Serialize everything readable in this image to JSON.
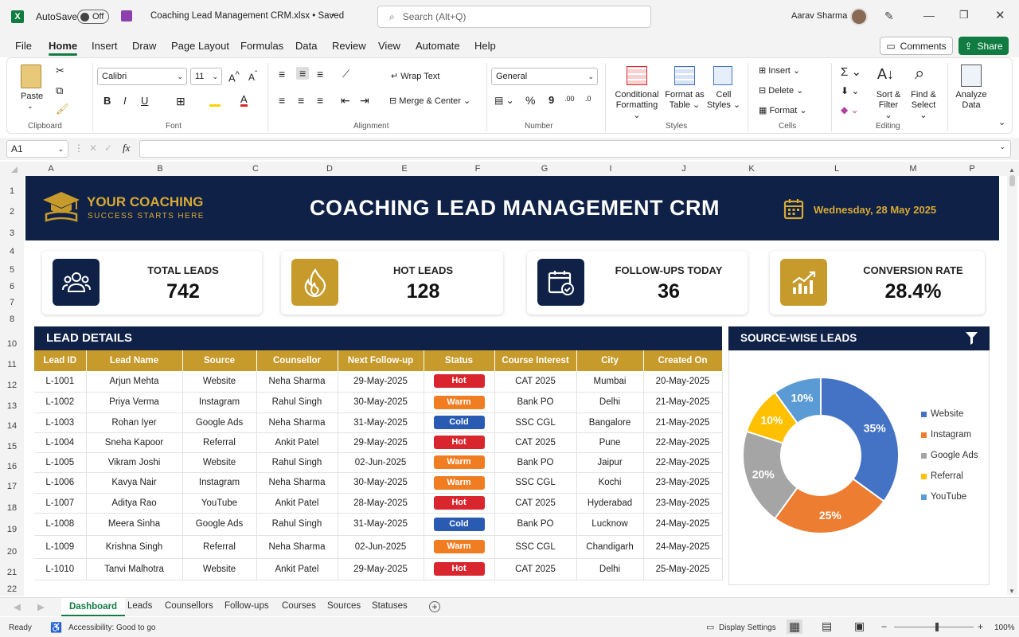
{
  "titlebar": {
    "autosave_label": "AutoSave",
    "autosave_state": "Off",
    "filename": "Coaching Lead Management CRM.xlsx • Saved",
    "search_placeholder": "Search (Alt+Q)",
    "user_name": "Aarav Sharma"
  },
  "menu": {
    "items": [
      "File",
      "Home",
      "Insert",
      "Draw",
      "Page Layout",
      "Formulas",
      "Data",
      "Review",
      "View",
      "Automate",
      "Help"
    ],
    "active": "Home",
    "comments_label": "Comments",
    "share_label": "Share"
  },
  "ribbon": {
    "clipboard": {
      "label": "Clipboard",
      "paste": "Paste"
    },
    "font": {
      "label": "Font",
      "font_name": "Calibri",
      "font_size": "11"
    },
    "alignment": {
      "label": "Alignment",
      "wrap_text": "Wrap Text",
      "merge_center": "Merge & Center"
    },
    "number": {
      "label": "Number",
      "format": "General"
    },
    "styles": {
      "label": "Styles",
      "conditional_1": "Conditional",
      "conditional_2": "Formatting",
      "format_table_1": "Format as",
      "format_table_2": "Table",
      "cell_styles_1": "Cell",
      "cell_styles_2": "Styles"
    },
    "cells": {
      "label": "Cells",
      "insert": "Insert",
      "delete": "Delete",
      "format": "Format"
    },
    "editing": {
      "label": "Editing",
      "sort_1": "Sort &",
      "sort_2": "Filter",
      "find_1": "Find &",
      "find_2": "Select"
    },
    "analyze": {
      "line1": "Analyze",
      "line2": "Data"
    }
  },
  "formula_bar": {
    "name_box": "A1",
    "fx": "fx",
    "formula": ""
  },
  "columns": [
    "A",
    "B",
    "C",
    "D",
    "E",
    "F",
    "G",
    "I",
    "J",
    "K",
    "L",
    "M",
    "P"
  ],
  "rows": [
    "1",
    "2",
    "3",
    "4",
    "5",
    "6",
    "7",
    "8",
    "9",
    "10",
    "11",
    "12",
    "13",
    "14",
    "15",
    "16",
    "17",
    "18",
    "19",
    "20",
    "21",
    "22"
  ],
  "banner": {
    "brand_line1": "YOUR COACHING",
    "brand_line2": "SUCCESS STARTS HERE",
    "title": "COACHING LEAD MANAGEMENT CRM",
    "date": "Wednesday, 28 May 2025"
  },
  "kpis": [
    {
      "title": "TOTAL LEADS",
      "value": "742",
      "icon": "users-icon"
    },
    {
      "title": "HOT LEADS",
      "value": "128",
      "icon": "flame-icon"
    },
    {
      "title": "FOLLOW-UPS TODAY",
      "value": "36",
      "icon": "calendar-check-icon"
    },
    {
      "title": "CONVERSION RATE",
      "value": "28.4%",
      "icon": "growth-chart-icon"
    }
  ],
  "lead_details": {
    "title": "LEAD DETAILS",
    "headers": [
      "Lead ID",
      "Lead Name",
      "Source",
      "Counsellor",
      "Next Follow-up",
      "Status",
      "Course Interest",
      "City",
      "Created On"
    ],
    "rows": [
      [
        "L-1001",
        "Arjun Mehta",
        "Website",
        "Neha Sharma",
        "29-May-2025",
        "Hot",
        "CAT 2025",
        "Mumbai",
        "20-May-2025"
      ],
      [
        "L-1002",
        "Priya Verma",
        "Instagram",
        "Rahul Singh",
        "30-May-2025",
        "Warm",
        "Bank PO",
        "Delhi",
        "21-May-2025"
      ],
      [
        "L-1003",
        "Rohan Iyer",
        "Google Ads",
        "Neha Sharma",
        "31-May-2025",
        "Cold",
        "SSC CGL",
        "Bangalore",
        "21-May-2025"
      ],
      [
        "L-1004",
        "Sneha Kapoor",
        "Referral",
        "Ankit Patel",
        "29-May-2025",
        "Hot",
        "CAT 2025",
        "Pune",
        "22-May-2025"
      ],
      [
        "L-1005",
        "Vikram Joshi",
        "Website",
        "Rahul Singh",
        "02-Jun-2025",
        "Warm",
        "Bank PO",
        "Jaipur",
        "22-May-2025"
      ],
      [
        "L-1006",
        "Kavya Nair",
        "Instagram",
        "Neha Sharma",
        "30-May-2025",
        "Warm",
        "SSC CGL",
        "Kochi",
        "23-May-2025"
      ],
      [
        "L-1007",
        "Aditya Rao",
        "YouTube",
        "Ankit Patel",
        "28-May-2025",
        "Hot",
        "CAT 2025",
        "Hyderabad",
        "23-May-2025"
      ],
      [
        "L-1008",
        "Meera Sinha",
        "Google Ads",
        "Rahul Singh",
        "31-May-2025",
        "Cold",
        "Bank PO",
        "Lucknow",
        "24-May-2025"
      ],
      [
        "L-1009",
        "Krishna Singh",
        "Referral",
        "Neha Sharma",
        "02-Jun-2025",
        "Warm",
        "SSC CGL",
        "Chandigarh",
        "24-May-2025"
      ],
      [
        "L-1010",
        "Tanvi Malhotra",
        "Website",
        "Ankit Patel",
        "29-May-2025",
        "Hot",
        "CAT 2025",
        "Delhi",
        "25-May-2025"
      ]
    ],
    "status_colors": {
      "Hot": "#d9262e",
      "Warm": "#f07d22",
      "Cold": "#2a5bb3"
    }
  },
  "source_wise": {
    "title": "SOURCE-WISE LEADS"
  },
  "chart_data": {
    "type": "pie",
    "donut": true,
    "title": "SOURCE-WISE LEADS",
    "categories": [
      "Website",
      "Instagram",
      "Google Ads",
      "Referral",
      "YouTube"
    ],
    "values": [
      35,
      25,
      20,
      10,
      10
    ],
    "labels": [
      "35%",
      "25%",
      "20%",
      "10%",
      "10%"
    ],
    "colors": [
      "#4472c4",
      "#ed7d31",
      "#a5a5a5",
      "#ffc000",
      "#5b9bd5"
    ],
    "legend": "right"
  },
  "sheet_tabs": [
    "Dashboard",
    "Leads",
    "Counsellors",
    "Follow-ups",
    "Courses",
    "Sources",
    "Statuses"
  ],
  "active_tab": "Dashboard",
  "status": {
    "ready": "Ready",
    "accessibility": "Accessibility: Good to go",
    "display_settings": "Display Settings",
    "zoom": "100%"
  },
  "colors": {
    "navy": "#0f2147",
    "gold": "#c79a2c",
    "excel_green": "#107c41"
  }
}
